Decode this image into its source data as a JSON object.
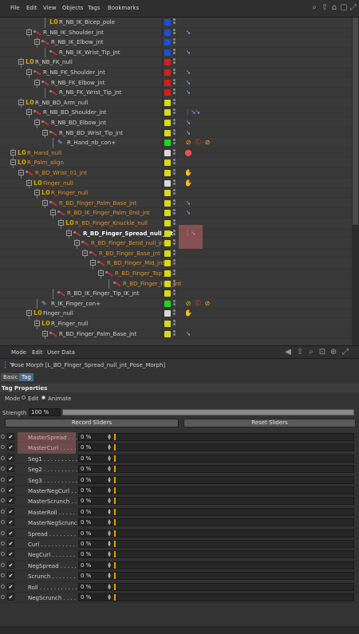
{
  "menubar": {
    "items": [
      "File",
      "Edit",
      "View",
      "Objects",
      "Tags",
      "Bookmarks"
    ],
    "icons": [
      "search-icon",
      "arrow-up-icon",
      "home-icon",
      "window-icon",
      "expand-icon"
    ]
  },
  "tree": {
    "rows": [
      {
        "label": "R_NB_IK_Bicep_pole",
        "depth": 4,
        "type": "null",
        "color": "#d0d0d0",
        "layer": "#1c4fd8",
        "tags": []
      },
      {
        "label": "R_NB_IK_Shoulder_jnt",
        "depth": 2,
        "type": "bone",
        "color": "#d0d0d0",
        "layer": "#1c4fd8",
        "tags": [
          "ik"
        ],
        "expanded": true
      },
      {
        "label": "R_NB_IK_Elbow_jnt",
        "depth": 3,
        "type": "bone",
        "color": "#d0d0d0",
        "layer": "#1c4fd8",
        "tags": [],
        "expanded": true
      },
      {
        "label": "R_NB_IK_Wrist_Tip_jnt",
        "depth": 4,
        "type": "bone",
        "color": "#d0d0d0",
        "layer": "#1c4fd8",
        "tags": [
          "ik"
        ]
      },
      {
        "label": "R_NB_FK_null",
        "depth": 1,
        "type": "null",
        "color": "#d0d0d0",
        "layer": "#d81c1c",
        "tags": [],
        "expanded": true
      },
      {
        "label": "R_NB_FK_Shoulder_jnt",
        "depth": 2,
        "type": "bone",
        "color": "#d0d0d0",
        "layer": "#d81c1c",
        "tags": [
          "ik"
        ],
        "expanded": true
      },
      {
        "label": "R_NB_FK_Elbow_jnt",
        "depth": 3,
        "type": "bone",
        "color": "#d0d0d0",
        "layer": "#d81c1c",
        "tags": [
          "ik"
        ],
        "expanded": true
      },
      {
        "label": "R_NB_FK_Wrist_Tip_jnt",
        "depth": 4,
        "type": "bone",
        "color": "#d0d0d0",
        "layer": "#d81c1c",
        "tags": [
          "ik"
        ]
      },
      {
        "label": "R_NB_BD_Arm_null",
        "depth": 1,
        "type": "null",
        "color": "#d0d0d0",
        "layer": "#d8d81c",
        "tags": [],
        "expanded": true
      },
      {
        "label": "R_NB_BD_Shoulder_jnt",
        "depth": 2,
        "type": "bone",
        "color": "#d0d0d0",
        "layer": "#d8d81c",
        "tags": [
          "pose",
          "ik"
        ],
        "expanded": true
      },
      {
        "label": "R_NB_BD_Elbow_jnt",
        "depth": 3,
        "type": "bone",
        "color": "#d0d0d0",
        "layer": "#d8d81c",
        "tags": [
          "ik"
        ],
        "expanded": true
      },
      {
        "label": "R_NB_BD_Wrist_Tip_jnt",
        "depth": 4,
        "type": "bone",
        "color": "#d0d0d0",
        "layer": "#d8d81c",
        "tags": [
          "ik"
        ],
        "expanded": true
      },
      {
        "label": "R_Hand_nb_con+",
        "depth": 5,
        "type": "ctrl",
        "color": "#d0d0d0",
        "layer": "#1cd81c",
        "tags": [
          "xp",
          "cc",
          "xp"
        ]
      },
      {
        "label": "R_Hand_null",
        "depth": 0,
        "type": "null",
        "color": "#e0912a",
        "layer": "#d8d8d8",
        "tags": [
          "red"
        ],
        "expanded": true
      },
      {
        "label": "R_Palm_align",
        "depth": 0,
        "type": "null",
        "color": "#e0912a",
        "layer": "#d8d81c",
        "tags": [],
        "expanded": true
      },
      {
        "label": "R_BD_Wrist_01_jnt",
        "depth": 1,
        "type": "bone",
        "color": "#e0912a",
        "layer": "#d8d81c",
        "tags": [
          "grab"
        ],
        "expanded": true
      },
      {
        "label": "Finger_null",
        "depth": 2,
        "type": "null",
        "color": "#e0912a",
        "layer": "#d8d8d8",
        "tags": [
          "grab"
        ],
        "expanded": true
      },
      {
        "label": "R_Finger_null",
        "depth": 3,
        "type": "null",
        "color": "#e0912a",
        "layer": "#d8d81c",
        "tags": [],
        "expanded": true
      },
      {
        "label": "R_BD_Finger_Palm_Base_jnt",
        "depth": 4,
        "type": "bone",
        "color": "#e0912a",
        "layer": "#d8d81c",
        "tags": [
          "ik"
        ],
        "expanded": true
      },
      {
        "label": "R_BD_IK_Finger_Palm_End_jnt",
        "depth": 5,
        "type": "bone",
        "color": "#e0912a",
        "layer": "#d8d81c",
        "tags": [
          "ik"
        ],
        "expanded": true
      },
      {
        "label": "R_BD_Finger_Knuckle_null",
        "depth": 6,
        "type": "null",
        "color": "#e0912a",
        "layer": "#d8d81c",
        "tags": [],
        "expanded": true
      },
      {
        "label": "R_BD_Finger_Spread_null_jnt",
        "depth": 7,
        "type": "bone",
        "color": "#ffffff",
        "layer": "#d8d81c",
        "tags": [
          "pose"
        ],
        "expanded": true
      },
      {
        "label": "R_BD_Finger_Bend_null_jnt",
        "depth": 8,
        "type": "bone",
        "color": "#e0912a",
        "layer": "#d8d81c",
        "tags": [],
        "expanded": true
      },
      {
        "label": "R_BD_Finger_Base_jnt",
        "depth": 9,
        "type": "bone",
        "color": "#e0912a",
        "layer": "#d8d81c",
        "tags": [],
        "expanded": true
      },
      {
        "label": "R_BD_Finger_Mid_jnt",
        "depth": 10,
        "type": "bone",
        "color": "#e0912a",
        "layer": "#d8d81c",
        "tags": [],
        "expanded": true
      },
      {
        "label": "R_BD_Finger_Top_jnt",
        "depth": 11,
        "type": "bone",
        "color": "#e0912a",
        "layer": "#d8d81c",
        "tags": [],
        "expanded": true
      },
      {
        "label": "R_BD_Finger_End_jnt",
        "depth": 12,
        "type": "bone",
        "color": "#e0912a",
        "layer": "#d8d81c",
        "tags": []
      },
      {
        "label": "R_BD_IK_Finger_Tip_IK_jnt",
        "depth": 5,
        "type": "bone",
        "color": "#d0d0d0",
        "layer": "#d8d81c",
        "tags": []
      },
      {
        "label": "R_IK_Finger_con+",
        "depth": 3,
        "type": "ctrl",
        "color": "#d0d0d0",
        "layer": "#1cd81c",
        "tags": [
          "xp",
          "cc",
          "xp"
        ]
      },
      {
        "label": "Finger_null",
        "depth": 2,
        "type": "null",
        "color": "#d0d0d0",
        "layer": "#d8d8d8",
        "tags": [
          "grab"
        ],
        "expanded": true
      },
      {
        "label": "R_Finger_null",
        "depth": 3,
        "type": "null",
        "color": "#d0d0d0",
        "layer": "#d8d81c",
        "tags": [],
        "expanded": true
      },
      {
        "label": "R_BD_Finger_Palm_Base_jnt",
        "depth": 4,
        "type": "bone",
        "color": "#d0d0d0",
        "layer": "#d8d81c",
        "tags": [
          "ik"
        ],
        "expanded": true
      }
    ]
  },
  "attr_menubar": {
    "items": [
      "Mode",
      "Edit",
      "User Data"
    ],
    "icons": [
      "arrow-left-icon",
      "arrow-up-icon",
      "search-icon",
      "lock-icon",
      "pin-icon",
      "expand-icon"
    ]
  },
  "object": {
    "title": "Pose Morph [L_BD_Finger_Spread_null_jnt_Pose_Morph]"
  },
  "tabs": [
    "Basic",
    "Tag"
  ],
  "active_tab": "Tag",
  "section": "Tag Properties",
  "mode": {
    "label": "Mode",
    "edit": "Edit",
    "animate": "Animate",
    "selected": "Animate"
  },
  "strength": {
    "label": "Strength",
    "value": "100 %"
  },
  "buttons": {
    "record": "Record Sliders",
    "reset": "Reset Sliders"
  },
  "sliders": [
    {
      "name": "MasterSpread",
      "value": "0 %",
      "checked": true
    },
    {
      "name": "MasterCurl",
      "value": "0 %",
      "checked": true
    },
    {
      "name": "Seg1",
      "value": "0 %",
      "checked": true
    },
    {
      "name": "Seg2",
      "value": "0 %",
      "checked": true
    },
    {
      "name": "Seg3",
      "value": "0 %",
      "checked": true
    },
    {
      "name": "MasterNegCurl",
      "value": "0 %",
      "checked": true
    },
    {
      "name": "MasterScrunch",
      "value": "0 %",
      "checked": true
    },
    {
      "name": "MasterRoll",
      "value": "0 %",
      "checked": true
    },
    {
      "name": "MasterNegScrunch",
      "value": "0 %",
      "checked": true
    },
    {
      "name": "Spread",
      "value": "0 %",
      "checked": true
    },
    {
      "name": "Curl",
      "value": "0 %",
      "checked": true
    },
    {
      "name": "NegCurl",
      "value": "0 %",
      "checked": true
    },
    {
      "name": "NegSpread",
      "value": "0 %",
      "checked": true
    },
    {
      "name": "Scrunch",
      "value": "0 %",
      "checked": true
    },
    {
      "name": "Roll",
      "value": "0 %",
      "checked": true
    },
    {
      "name": "NegScrunch",
      "value": "0 %",
      "checked": true
    }
  ]
}
